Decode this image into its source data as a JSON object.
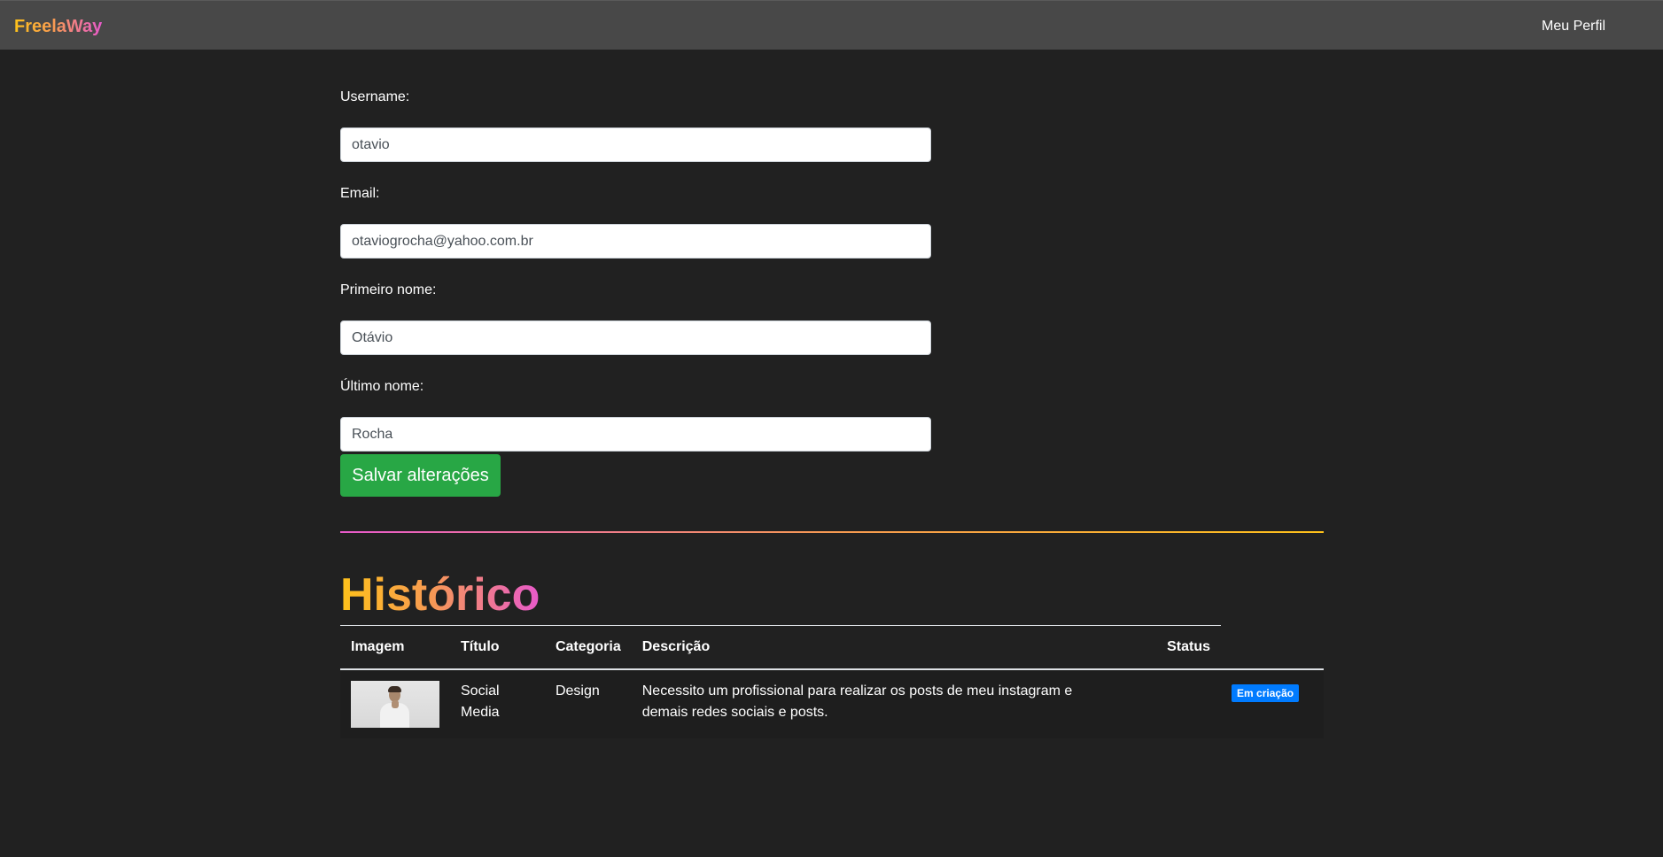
{
  "navbar": {
    "brand": "FreelaWay",
    "profile_link": "Meu Perfil"
  },
  "form": {
    "username_label": "Username:",
    "username_value": "otavio",
    "email_label": "Email:",
    "email_value": "otaviogrocha@yahoo.com.br",
    "first_name_label": "Primeiro nome:",
    "first_name_value": "Otávio",
    "last_name_label": "Último nome:",
    "last_name_value": "Rocha",
    "save_label": "Salvar alterações"
  },
  "history": {
    "title": "Histórico",
    "columns": {
      "image": "Imagem",
      "title": "Título",
      "category": "Categoria",
      "description": "Descrição",
      "status": "Status"
    },
    "rows": [
      {
        "title": "Social Media",
        "category": "Design",
        "description": "Necessito um profissional para realizar os posts de meu instagram e demais redes sociais e posts.",
        "status": "Em criação"
      }
    ]
  },
  "colors": {
    "background": "#212121",
    "navbar": "#484848",
    "save_button": "#28a745",
    "status_badge": "#007bff",
    "gradient_yellow": "#ffc21a",
    "gradient_pink": "#e85acb"
  }
}
